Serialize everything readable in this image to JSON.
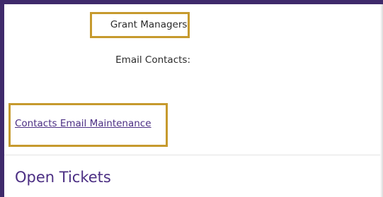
{
  "details": {
    "grant_managers_label": "Grant Managers:",
    "email_contacts_label": "Email Contacts:"
  },
  "links": {
    "contacts_email_maintenance": "Contacts Email Maintenance"
  },
  "sections": {
    "open_tickets_title": "Open Tickets"
  },
  "colors": {
    "frame": "#3f2a6b",
    "link": "#4b2e83",
    "highlight": "#c69a2e"
  }
}
